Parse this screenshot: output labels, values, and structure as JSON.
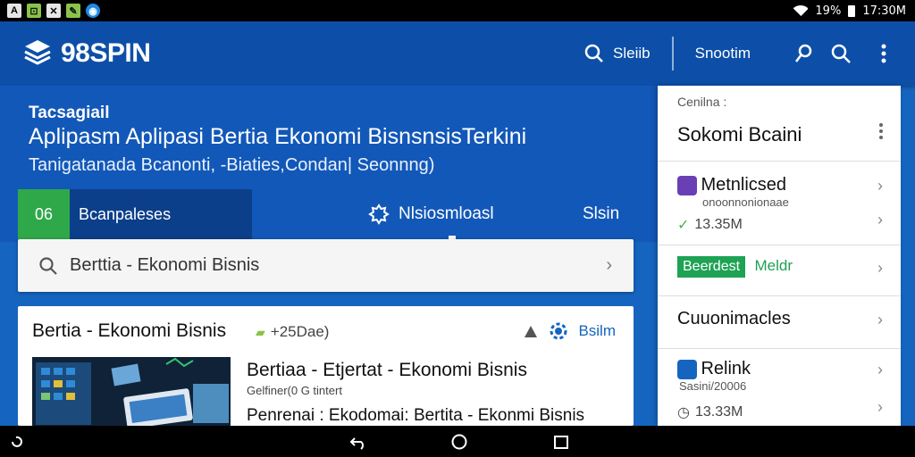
{
  "status_bar": {
    "battery_text": "19%",
    "time": "17:30M",
    "notification_icons": [
      "a-icon",
      "image-icon",
      "x-icon",
      "slash-icon",
      "vpn-icon"
    ],
    "notification_glyphs": [
      "A",
      "⊡",
      "✕",
      "✎",
      "◉"
    ]
  },
  "app_bar": {
    "logo_text": "98SPIN",
    "search_label": "Sleiib",
    "second_label": "Snootim",
    "accent": "#0d4fa8"
  },
  "hero": {
    "kicker": "Tacsagiail",
    "title": "Aplipasm Aplipasi Bertia Ekonomi BisnsnsisTerkini",
    "subtitle": "Tanigatanada Bcanonti, -Biaties,Condan| Seonnng)"
  },
  "tabs": {
    "badge": "06",
    "first": "Bcanpaleses",
    "middle": "Nlsiosmloasl",
    "last": "Slsin"
  },
  "search": {
    "text": "Berttia - Ekonomi Bisnis"
  },
  "card": {
    "heading": "Bertia - Ekonomi Bisnis",
    "date": "+25Dae)",
    "action_label": "Bsilm",
    "article_title": "Bertiaa - Etjertat - Ekonomi Bisnis",
    "article_meta": "Gelfiner(0 G tintert",
    "article_snippet": "Penrenai : Ekodomai: Bertita - Ekonmi Bisnis"
  },
  "panel": {
    "label": "Cenilna :",
    "title": "Sokomi Bcaini",
    "items": [
      {
        "name": "Metnlicsed",
        "sub": "onoonnonionaae",
        "size": "13.35M"
      },
      {
        "badge": "Beerdest",
        "text": "Meldr"
      },
      {
        "name": "Cuuonimacles"
      },
      {
        "name": "Relink",
        "sub": "Sasini/20006",
        "size": "13.33M"
      }
    ]
  }
}
